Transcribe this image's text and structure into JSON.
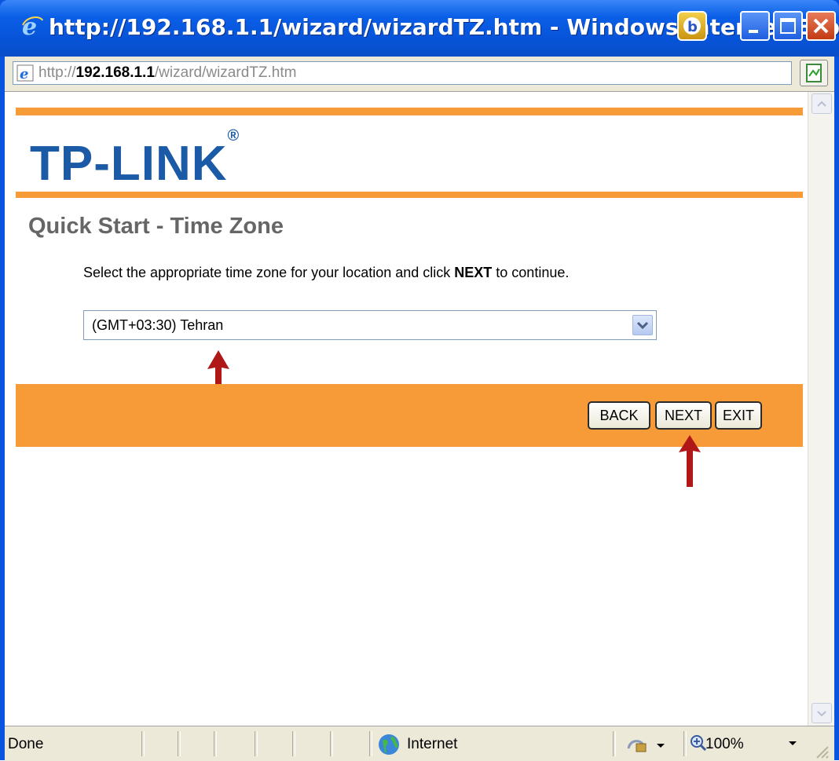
{
  "window": {
    "title": "http://192.168.1.1/wizard/wizardTZ.htm - Windows Internet Exp",
    "buttons": [
      "minimize",
      "maximize",
      "close"
    ]
  },
  "address_bar": {
    "scheme": "http://",
    "host": "192.168.1.1",
    "path": "/wizard/wizardTZ.htm"
  },
  "page": {
    "logo": "TP-LINK",
    "logo_mark": "®",
    "heading": "Quick Start - Time Zone",
    "instruction_before": "Select the appropriate time zone for your location and click ",
    "instruction_bold": "NEXT",
    "instruction_after": " to continue.",
    "timezone_selected": "(GMT+03:30) Tehran",
    "buttons": {
      "back": "BACK",
      "next": "NEXT",
      "exit": "EXIT"
    }
  },
  "status_bar": {
    "status": "Done",
    "zone": "Internet",
    "zoom": "100%"
  },
  "colors": {
    "accent_orange": "#f79a38",
    "logo_blue": "#1a5aa6",
    "annotation_arrow": "#b01818"
  }
}
